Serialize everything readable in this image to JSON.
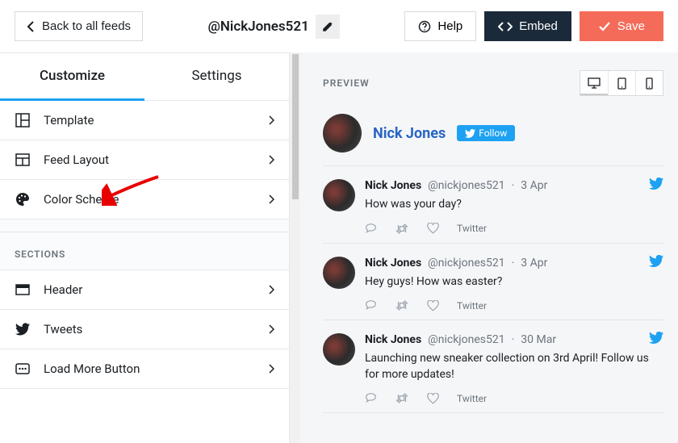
{
  "header": {
    "back_label": "Back to all feeds",
    "feed_title": "@NickJones521",
    "help_label": "Help",
    "embed_label": "Embed",
    "save_label": "Save"
  },
  "sidebar": {
    "tabs": {
      "customize": "Customize",
      "settings": "Settings"
    },
    "items": {
      "template": "Template",
      "feed_layout": "Feed Layout",
      "color_scheme": "Color Scheme"
    },
    "sections_label": "SECTIONS",
    "section_items": {
      "header": "Header",
      "tweets": "Tweets",
      "load_more": "Load More Button"
    }
  },
  "preview": {
    "label": "PREVIEW",
    "profile": {
      "name": "Nick Jones",
      "follow": "Follow"
    },
    "tweets": [
      {
        "name": "Nick Jones",
        "handle": "@nickjones521",
        "date": "3 Apr",
        "text": "How was your day?",
        "source": "Twitter"
      },
      {
        "name": "Nick Jones",
        "handle": "@nickjones521",
        "date": "3 Apr",
        "text": "Hey guys! How was easter?",
        "source": "Twitter"
      },
      {
        "name": "Nick Jones",
        "handle": "@nickjones521",
        "date": "30 Mar",
        "text": "Launching new sneaker collection on 3rd April! Follow us for more updates!",
        "source": "Twitter"
      }
    ]
  }
}
